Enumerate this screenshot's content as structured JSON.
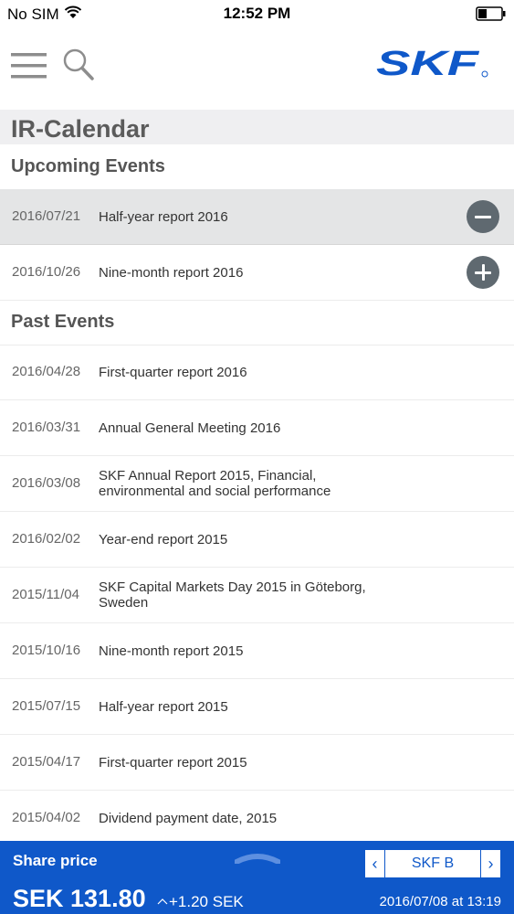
{
  "status_bar": {
    "carrier": "No SIM",
    "time": "12:52 PM"
  },
  "nav": {
    "menu_icon": "hamburger-icon",
    "search_icon": "search-icon",
    "logo_text": "SKF",
    "brand_color": "#0f58c9"
  },
  "page": {
    "title": "IR-Calendar"
  },
  "upcoming": {
    "heading": "Upcoming Events",
    "items": [
      {
        "date": "2016/07/21",
        "title": "Half-year report 2016",
        "action": "remove"
      },
      {
        "date": "2016/10/26",
        "title": "Nine-month report 2016",
        "action": "add"
      }
    ]
  },
  "past": {
    "heading": "Past Events",
    "items": [
      {
        "date": "2016/04/28",
        "title": "First-quarter report 2016"
      },
      {
        "date": "2016/03/31",
        "title": "Annual General Meeting 2016"
      },
      {
        "date": "2016/03/08",
        "title": "SKF Annual Report 2015, Financial, environmental and social performance"
      },
      {
        "date": "2016/02/02",
        "title": "Year-end report 2015"
      },
      {
        "date": "2015/11/04",
        "title": "SKF Capital Markets Day 2015 in Göteborg, Sweden"
      },
      {
        "date": "2015/10/16",
        "title": "Nine-month report 2015"
      },
      {
        "date": "2015/07/15",
        "title": "Half-year report 2015"
      },
      {
        "date": "2015/04/17",
        "title": "First-quarter report 2015"
      },
      {
        "date": "2015/04/02",
        "title": "Dividend payment date, 2015"
      }
    ]
  },
  "share": {
    "label": "Share price",
    "ticker": "SKF B",
    "prev_arrow": "‹",
    "next_arrow": "›",
    "price": "SEK 131.80",
    "change": "+1.20 SEK",
    "timestamp": "2016/07/08 at 13:19"
  }
}
